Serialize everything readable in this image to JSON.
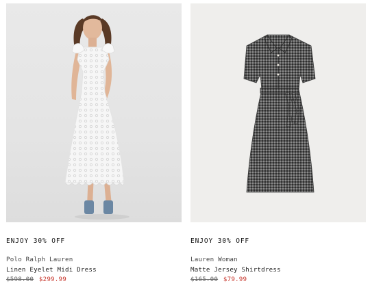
{
  "products": [
    {
      "promo": "ENJOY 30% OFF",
      "brand": "Polo Ralph Lauren",
      "name": "Linen Eyelet Midi Dress",
      "original_price": "$598.00",
      "sale_price": "$299.99",
      "image": "white-eyelet-dress-model"
    },
    {
      "promo": "ENJOY 30% OFF",
      "brand": "Lauren Woman",
      "name": "Matte Jersey Shirtdress",
      "original_price": "$165.00",
      "sale_price": "$79.99",
      "image": "black-white-print-shirtdress"
    }
  ],
  "colors": {
    "sale": "#c8372d",
    "text": "#222222",
    "strike": "#666666"
  }
}
